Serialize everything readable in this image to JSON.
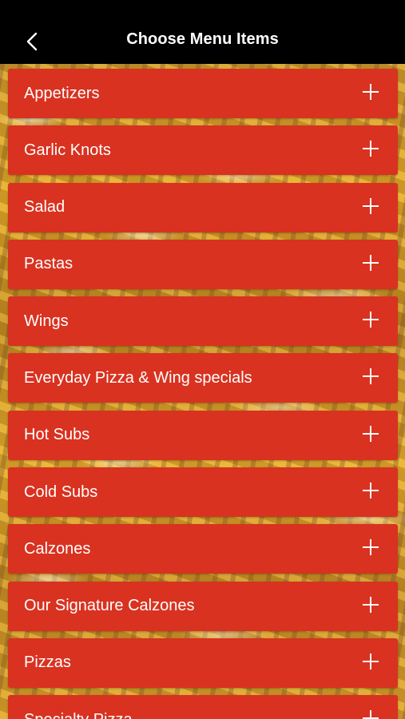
{
  "header": {
    "title": "Choose Menu Items",
    "back_icon": "chevron-left-icon"
  },
  "menu": {
    "items": [
      {
        "label": "Appetizers"
      },
      {
        "label": "Garlic Knots"
      },
      {
        "label": "Salad"
      },
      {
        "label": "Pastas"
      },
      {
        "label": "Wings"
      },
      {
        "label": "Everyday Pizza & Wing specials"
      },
      {
        "label": "Hot Subs"
      },
      {
        "label": "Cold Subs"
      },
      {
        "label": "Calzones"
      },
      {
        "label": "Our Signature Calzones"
      },
      {
        "label": "Pizzas"
      },
      {
        "label": "Specialty Pizza"
      }
    ],
    "expand_icon": "plus-icon"
  },
  "colors": {
    "header_background": "#000000",
    "item_background": "#d93220",
    "text": "#ffffff"
  }
}
